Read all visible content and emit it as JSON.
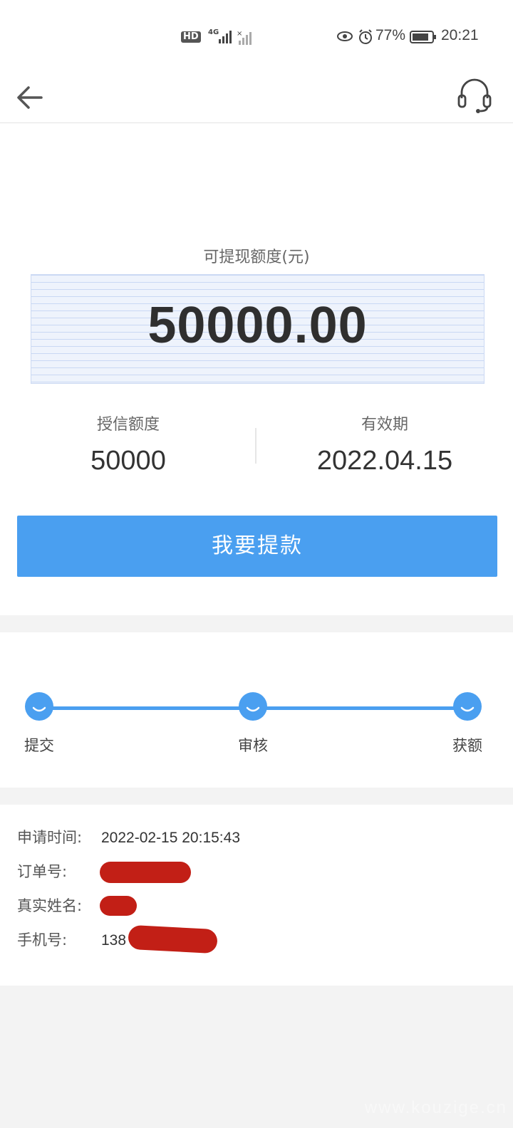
{
  "status_bar": {
    "hd_label": "HD",
    "network": "4G",
    "battery": "77%",
    "time": "20:21"
  },
  "header": {
    "back_icon": "arrow-left-icon",
    "service_icon": "headset-icon"
  },
  "summary": {
    "available_label": "可提现额度(元)",
    "available_amount": "50000.00",
    "credit_label": "授信额度",
    "credit_value": "50000",
    "expiry_label": "有效期",
    "expiry_value": "2022.04.15",
    "withdraw_button": "我要提款"
  },
  "progress": {
    "steps": [
      {
        "label": "提交"
      },
      {
        "label": "审核"
      },
      {
        "label": "获额"
      }
    ],
    "color": "#4a9ff0"
  },
  "details": {
    "apply_time_label": "申请时间:",
    "apply_time_value": "2022-02-15 20:15:43",
    "order_label": "订单号:",
    "name_label": "真实姓名:",
    "phone_label": "手机号:",
    "phone_value": "138"
  },
  "watermark": "www.kouzige.cn",
  "colors": {
    "accent": "#4a9ff0",
    "redaction": "#c21f16"
  }
}
